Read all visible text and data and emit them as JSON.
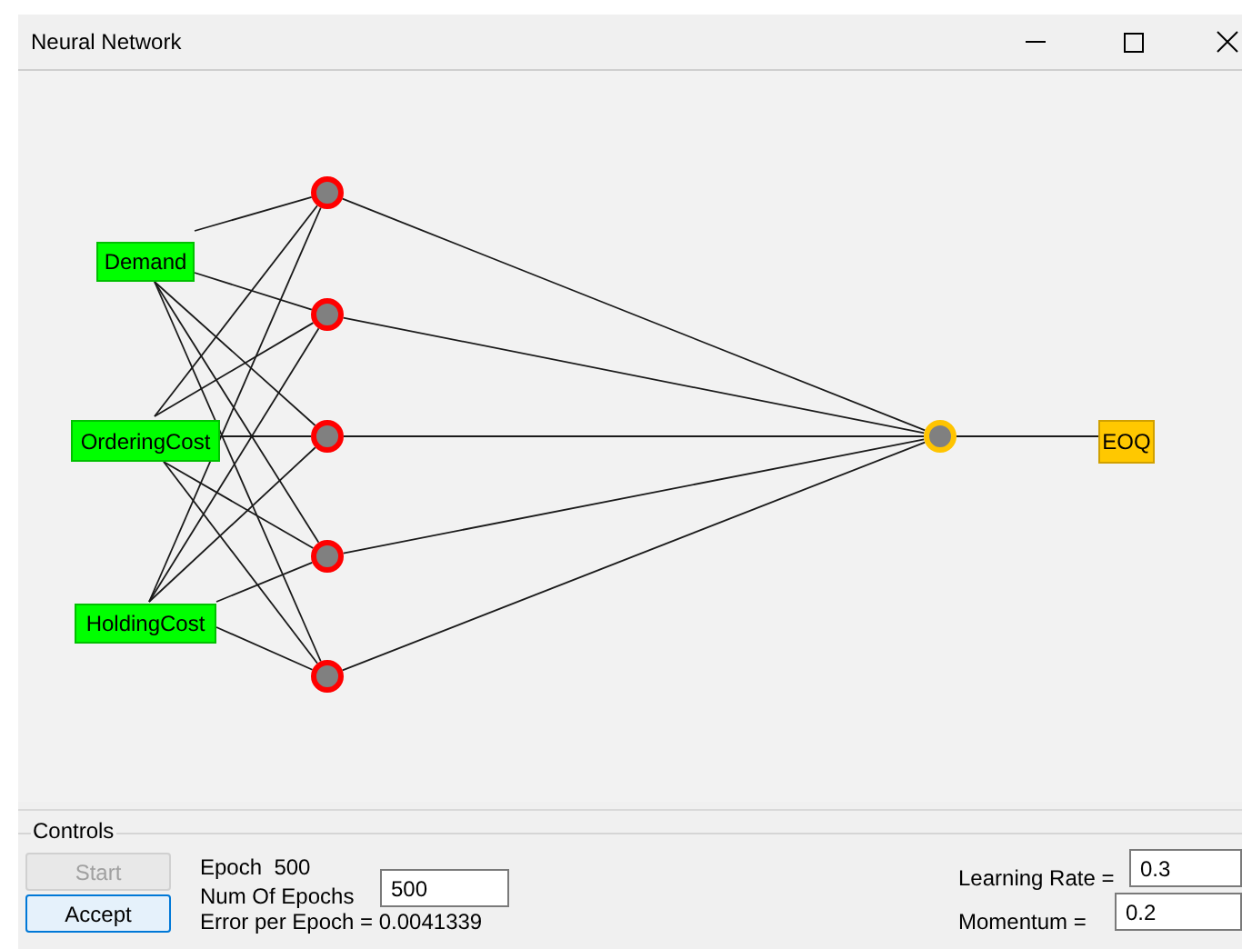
{
  "window": {
    "title": "Neural Network"
  },
  "network": {
    "inputs": [
      {
        "label": "Demand"
      },
      {
        "label": "OrderingCost"
      },
      {
        "label": "HoldingCost"
      }
    ],
    "outputs": [
      {
        "label": "EOQ"
      }
    ]
  },
  "controls": {
    "title": "Controls",
    "buttons": [
      {
        "label": "Start",
        "disabled": true,
        "focused": false
      },
      {
        "label": "Accept",
        "disabled": false,
        "focused": true
      }
    ],
    "epoch": "Epoch  500",
    "num_epochs": {
      "label": "Num Of Epochs",
      "value": "500"
    },
    "error": "Error per Epoch = 0.0041339",
    "learning_rate": {
      "label": "Learning Rate =",
      "value": "0.3"
    },
    "momentum": {
      "label": "Momentum =",
      "value": "0.2"
    }
  }
}
